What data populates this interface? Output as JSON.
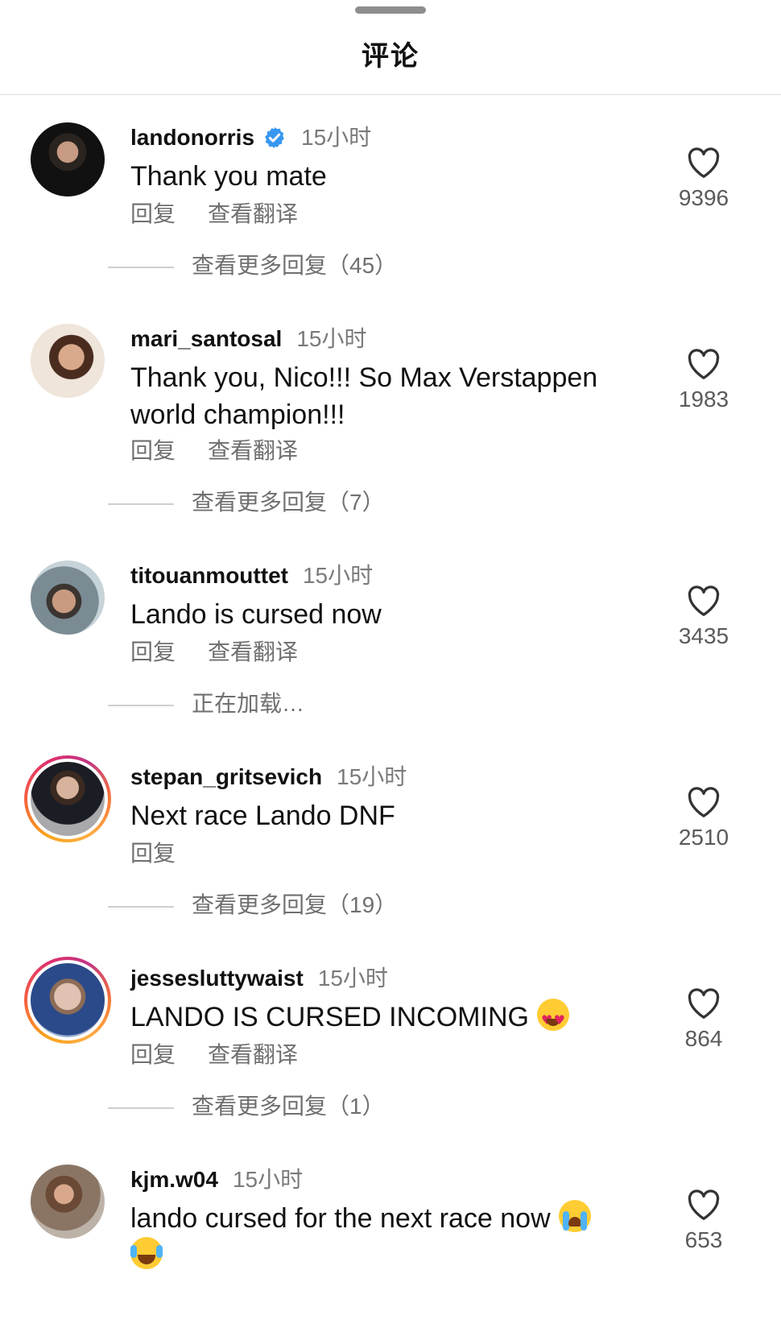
{
  "header": {
    "title": "评论"
  },
  "labels": {
    "reply": "回复",
    "translate": "查看翻译"
  },
  "comments": [
    {
      "username": "landonorris",
      "verified": true,
      "time": "15小时",
      "text": "Thank you mate",
      "likes": "9396",
      "show_translate": true,
      "replies_label": "查看更多回复（45）",
      "story_ring": false,
      "avatar": "profile-photo"
    },
    {
      "username": "mari_santosal",
      "verified": false,
      "time": "15小时",
      "text": "Thank you, Nico!!! So Max Verstappen world champion!!!",
      "likes": "1983",
      "show_translate": true,
      "replies_label": "查看更多回复（7）",
      "story_ring": false,
      "avatar": "profile-photo"
    },
    {
      "username": "titouanmouttet",
      "verified": false,
      "time": "15小时",
      "text": "Lando is cursed now",
      "likes": "3435",
      "show_translate": true,
      "replies_label": "正在加载…",
      "story_ring": false,
      "avatar": "profile-photo"
    },
    {
      "username": "stepan_gritsevich",
      "verified": false,
      "time": "15小时",
      "text": "Next race Lando DNF",
      "likes": "2510",
      "show_translate": false,
      "replies_label": "查看更多回复（19）",
      "story_ring": true,
      "avatar": "profile-photo"
    },
    {
      "username": "jessesluttywaist",
      "verified": false,
      "time": "15小时",
      "text": "LANDO IS CURSED INCOMING",
      "emoji": "heart-eyes-emoji",
      "likes": "864",
      "show_translate": true,
      "replies_label": "查看更多回复（1）",
      "story_ring": true,
      "avatar": "profile-photo"
    },
    {
      "username": "kjm.w04",
      "verified": false,
      "time": "15小时",
      "text": "lando cursed for the next race now",
      "emoji": "sob-emoji",
      "emoji2": "joy-emoji",
      "likes": "653",
      "show_translate": false,
      "replies_label": "",
      "story_ring": false,
      "avatar": "profile-photo"
    }
  ],
  "icons": {
    "like": "heart-outline-icon",
    "verified": "verified-badge-icon"
  },
  "colors": {
    "verified": "#3897f0",
    "muted_text": "#7a7a7a",
    "story_ring_start": "#f9a31b",
    "story_ring_end": "#c13584"
  }
}
